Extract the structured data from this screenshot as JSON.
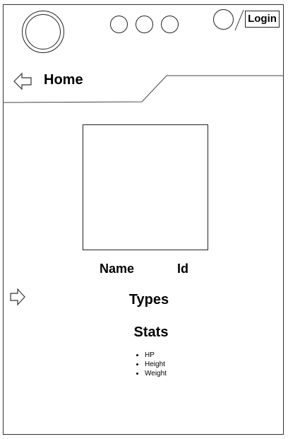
{
  "header": {
    "login_label": "Login"
  },
  "nav": {
    "title": "Home"
  },
  "detail": {
    "name_label": "Name",
    "id_label": "Id",
    "types_label": "Types",
    "stats_label": "Stats",
    "stats_items": [
      "HP",
      "Height",
      "Weight"
    ]
  }
}
